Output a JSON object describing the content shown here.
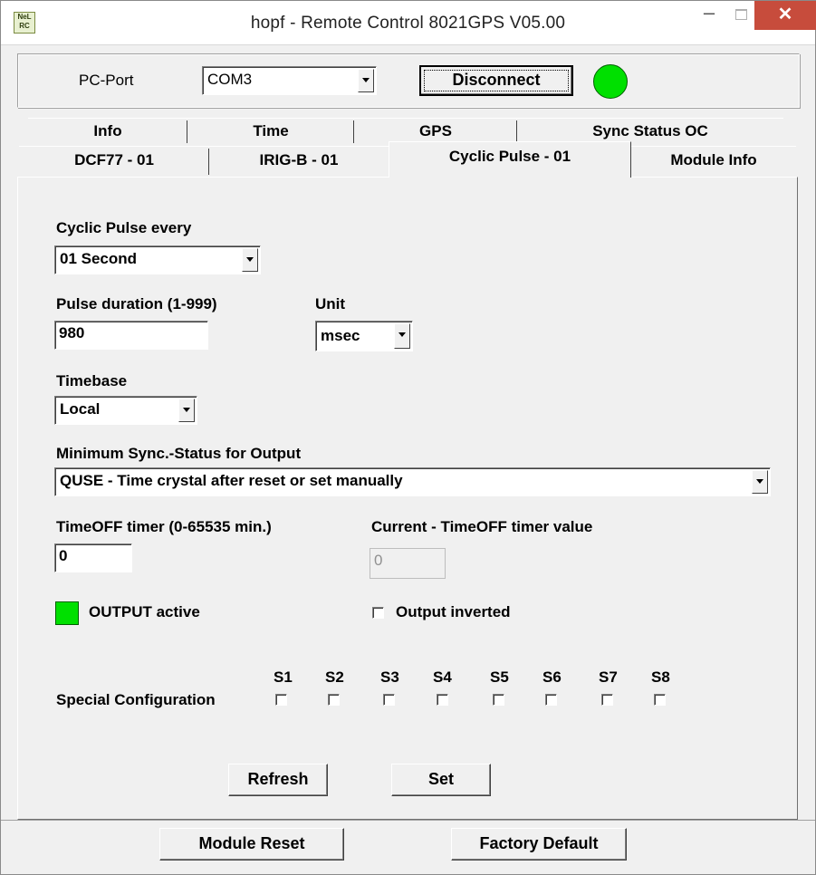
{
  "window": {
    "title": "hopf - Remote Control  8021GPS V05.00",
    "icon_text": "NeL RC",
    "minimize": "–",
    "close": "✕"
  },
  "port": {
    "label": "PC-Port",
    "value": "COM3",
    "disconnect_label": "Disconnect",
    "status_color": "#00e000"
  },
  "tabs_row1": [
    "Info",
    "Time",
    "GPS",
    "Sync Status OC"
  ],
  "tabs_row2": [
    "DCF77 - 01",
    "IRIG-B - 01",
    "Cyclic Pulse - 01",
    "Module Info"
  ],
  "form": {
    "cyclic_label": "Cyclic Pulse every",
    "cyclic_value": "01 Second",
    "duration_label": "Pulse duration (1-999)",
    "duration_value": "980",
    "unit_label": "Unit",
    "unit_value": "msec",
    "timebase_label": "Timebase",
    "timebase_value": "Local",
    "minsync_label": "Minimum Sync.-Status for Output",
    "minsync_value": "QUSE - Time crystal after reset or set manually",
    "timeoff_label": "TimeOFF timer (0-65535 min.)",
    "timeoff_value": "0",
    "current_timeoff_label": "Current - TimeOFF timer value",
    "current_timeoff_value": "0",
    "output_active_label": "OUTPUT active",
    "output_active_color": "#00e000",
    "output_inverted_label": "Output inverted",
    "special_label": "Special Configuration",
    "switches": [
      "S1",
      "S2",
      "S3",
      "S4",
      "S5",
      "S6",
      "S7",
      "S8"
    ],
    "refresh_label": "Refresh",
    "set_label": "Set"
  },
  "footer": {
    "reset_label": "Module Reset",
    "factory_label": "Factory Default"
  }
}
